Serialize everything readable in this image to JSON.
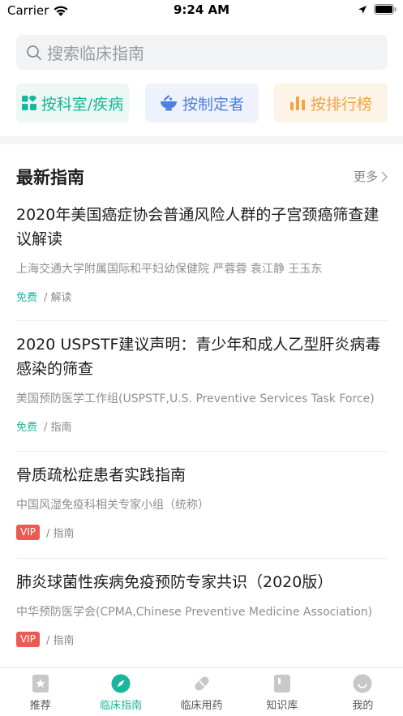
{
  "status_bar": {
    "carrier": "Carrier",
    "time": "9:24 AM"
  },
  "search": {
    "placeholder": "搜索临床指南"
  },
  "categories": [
    {
      "label": "按科室/疾病",
      "icon": "grid-icon",
      "color": "#18b69b"
    },
    {
      "label": "按制定者",
      "icon": "bowl-icon",
      "color": "#4f82dc"
    },
    {
      "label": "按排行榜",
      "icon": "bar-chart-icon",
      "color": "#f1a441"
    }
  ],
  "section": {
    "title": "最新指南",
    "more": "更多"
  },
  "guides": [
    {
      "title": "2020年美国癌症协会普通风险人群的子宫颈癌筛查建议解读",
      "org": "上海交通大学附属国际和平妇幼保健院 严蓉蓉 袁江静 王玉东",
      "tag": "免费",
      "type": "/ 解读"
    },
    {
      "title": "2020 USPSTF建议声明：青少年和成人乙型肝炎病毒感染的筛查",
      "org": "美国预防医学工作组(USPSTF,U.S. Preventive Services Task Force)",
      "tag": "免费",
      "type": "/ 指南"
    },
    {
      "title": "骨质疏松症患者实践指南",
      "org": "中国风湿免疫科相关专家小组（统称）",
      "tag": "VIP",
      "type": "/ 指南"
    },
    {
      "title": "肺炎球菌性疾病免疫预防专家共识（2020版）",
      "org": "中华预防医学会(CPMA,Chinese Preventive Medicine Association)",
      "tag": "VIP",
      "type": "/ 指南"
    }
  ],
  "tabs": [
    {
      "label": "推荐",
      "icon": "star-card-icon",
      "active": false
    },
    {
      "label": "临床指南",
      "icon": "compass-icon",
      "active": true
    },
    {
      "label": "临床用药",
      "icon": "pill-icon",
      "active": false
    },
    {
      "label": "知识库",
      "icon": "book-icon",
      "active": false
    },
    {
      "label": "我的",
      "icon": "user-icon",
      "active": false
    }
  ],
  "colors": {
    "accent": "#18b69b",
    "vip": "#ec5a54",
    "inactive_icon": "#c8c8c8"
  }
}
